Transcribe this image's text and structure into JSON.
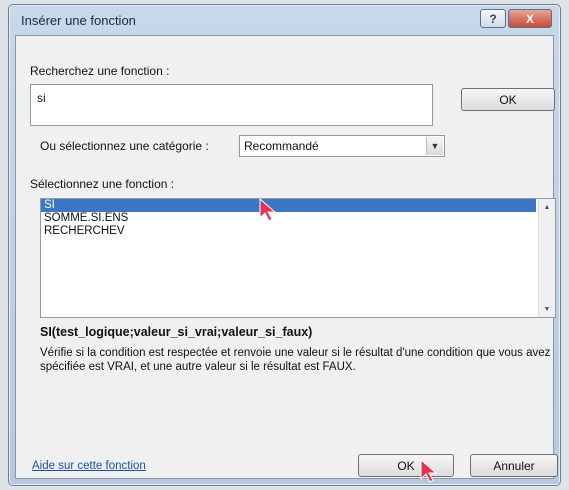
{
  "window": {
    "title": "Insérer une fonction",
    "help_icon": "?",
    "close_icon": "X"
  },
  "search": {
    "label": "Recherchez une fonction :",
    "value": "si",
    "ok_label": "OK"
  },
  "category": {
    "label": "Ou sélectionnez une catégorie :",
    "selected": "Recommandé"
  },
  "functions": {
    "label": "Sélectionnez une fonction :",
    "items": [
      "SI",
      "SOMME.SI.ENS",
      "RECHERCHEV"
    ],
    "selected_index": 0,
    "syntax": "SI(test_logique;valeur_si_vrai;valeur_si_faux)",
    "description": "Vérifie si la condition est respectée et renvoie une valeur si le résultat d'une condition que vous avez spécifiée est VRAI, et une autre valeur si le résultat est FAUX."
  },
  "footer": {
    "help_link": "Aide sur cette fonction",
    "ok_label": "OK",
    "cancel_label": "Annuler"
  },
  "colors": {
    "selection": "#3b77c4",
    "cursor": "#e8324f",
    "link": "#1a4fb5"
  }
}
